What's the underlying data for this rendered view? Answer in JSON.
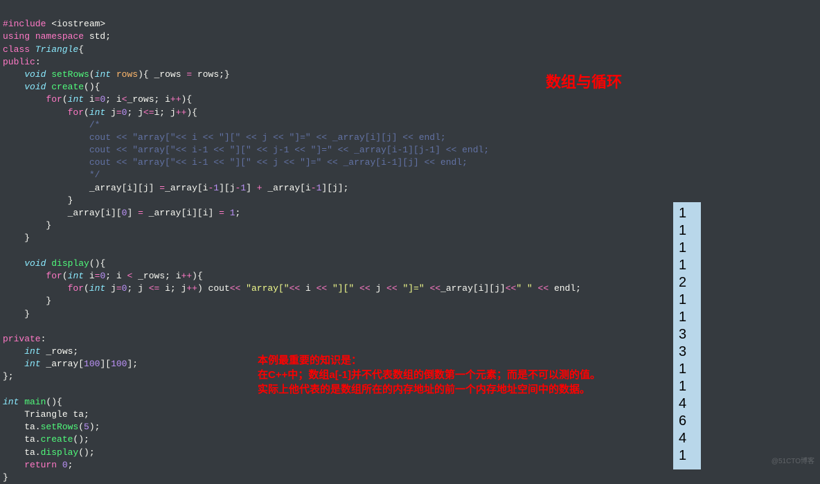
{
  "code": {
    "l1": {
      "a": "#include",
      "b": " <iostream>"
    },
    "l2": {
      "a": "using",
      "b": " namespace",
      "c": " std",
      "d": ";"
    },
    "l3": {
      "a": "class",
      "b": " Triangle",
      "c": "{"
    },
    "l4": {
      "a": "public",
      "b": ":"
    },
    "l5": {
      "a": "    ",
      "b": "void",
      "c": " setRows",
      "d": "(",
      "e": "int",
      "f": " rows",
      "g": "){ _rows ",
      "h": "=",
      "i": " rows;}"
    },
    "l6": {
      "a": "    ",
      "b": "void",
      "c": " create",
      "d": "(){"
    },
    "l7": {
      "a": "        ",
      "b": "for",
      "c": "(",
      "d": "int",
      "e": " i",
      "f": "=",
      "g": "0",
      "h": "; i",
      "i": "<",
      "j": "_rows; i",
      "k": "++",
      "l": "){"
    },
    "l8": {
      "a": "            ",
      "b": "for",
      "c": "(",
      "d": "int",
      "e": " j",
      "f": "=",
      "g": "0",
      "h": "; j",
      "i": "<=",
      "j": "i; j",
      "k": "++",
      "l": "){"
    },
    "l9": {
      "a": "                ",
      "b": "/*"
    },
    "l10": {
      "a": "                cout << \"array[\"<< i << \"][\" << j << \"]=\" << _array[i][j] << endl;"
    },
    "l11": {
      "a": "                cout << \"array[\"<< i-1 << \"][\" << j-1 << \"]=\" << _array[i-1][j-1] << endl;"
    },
    "l12": {
      "a": "                cout << \"array[\"<< i-1 << \"][\" << j << \"]=\" << _array[i-1][j] << endl;"
    },
    "l13": {
      "a": "                ",
      "b": "*/"
    },
    "l14": {
      "a": "                _array[i][j] ",
      "b": "=",
      "c": "_array[i",
      "d": "-",
      "e": "1",
      "f": "][j",
      "g": "-",
      "h": "1",
      "i": "] ",
      "j": "+",
      "k": " _array[i",
      "l": "-",
      "m": "1",
      "n": "][j];"
    },
    "l15": {
      "a": "            }"
    },
    "l16": {
      "a": "            _array[i][",
      "b": "0",
      "c": "] ",
      "d": "=",
      "e": " _array[i][i] ",
      "f": "=",
      "g": " ",
      "h": "1",
      "i": ";"
    },
    "l17": {
      "a": "        }"
    },
    "l18": {
      "a": "    }"
    },
    "l19": {
      "a": ""
    },
    "l20": {
      "a": "    ",
      "b": "void",
      "c": " display",
      "d": "(){"
    },
    "l21": {
      "a": "        ",
      "b": "for",
      "c": "(",
      "d": "int",
      "e": " i",
      "f": "=",
      "g": "0",
      "h": "; i ",
      "i": "<",
      "j": " _rows; i",
      "k": "++",
      "l": "){"
    },
    "l22": {
      "a": "            ",
      "b": "for",
      "c": "(",
      "d": "int",
      "e": " j",
      "f": "=",
      "g": "0",
      "h": "; j ",
      "i": "<=",
      "j": " i; j",
      "k": "++",
      "l": ") cout",
      "m": "<<",
      "n": " \"array[\"",
      "o": "<<",
      "p": " i ",
      "q": "<<",
      "r": " \"][\"",
      "s": " << ",
      "t": "j ",
      "u": "<<",
      "v": " \"]=\"",
      "w": " <<",
      "x": "_array[i][j]",
      "y": "<<",
      "z": "\" \"",
      "aa": " << ",
      "ab": "endl;"
    },
    "l23": {
      "a": "        }"
    },
    "l24": {
      "a": "    }"
    },
    "l25": {
      "a": ""
    },
    "l26": {
      "a": "private",
      "b": ":"
    },
    "l27": {
      "a": "    ",
      "b": "int",
      "c": " _rows;"
    },
    "l28": {
      "a": "    ",
      "b": "int",
      "c": " _array[",
      "d": "100",
      "e": "][",
      "f": "100",
      "g": "];"
    },
    "l29": {
      "a": "};"
    },
    "l30": {
      "a": ""
    },
    "l31": {
      "a": "int",
      "b": " main",
      "c": "(){"
    },
    "l32": {
      "a": "    Triangle ta;"
    },
    "l33": {
      "a": "    ta.",
      "b": "setRows",
      "c": "(",
      "d": "5",
      "e": ");"
    },
    "l34": {
      "a": "    ta.",
      "b": "create",
      "c": "();"
    },
    "l35": {
      "a": "    ta.",
      "b": "display",
      "c": "();"
    },
    "l36": {
      "a": "    ",
      "b": "return",
      "c": " ",
      "d": "0",
      "e": ";"
    },
    "l37": {
      "a": "}"
    }
  },
  "title": "数组与循环",
  "note": {
    "l1": "本例最重要的知识是：",
    "l2": "在C++中；数组a[-1]并不代表数组的倒数第一个元素；而是不可以测的值。",
    "l3": "实际上他代表的是数组所在的内存地址的前一个内存地址空间中的数据。"
  },
  "output": [
    "1",
    "1",
    "1",
    "1",
    "2",
    "1",
    "1",
    "3",
    "3",
    "1",
    "1",
    "4",
    "6",
    "4",
    "1"
  ],
  "watermark": "@51CTO博客"
}
